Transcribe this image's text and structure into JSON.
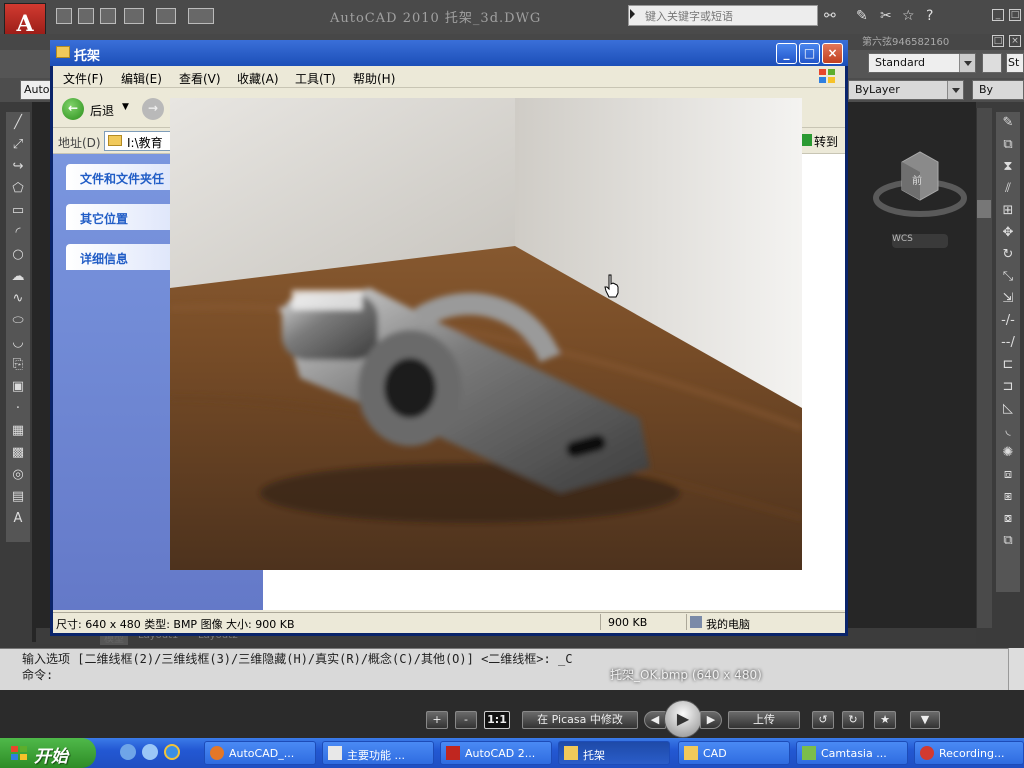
{
  "acad": {
    "title": "AutoCAD 2010  托架_3d.DWG",
    "search_placeholder": "键入关键字或短语",
    "user": "第六弦946582160",
    "style_combo": "Standard",
    "st_combo": "St",
    "workspace_combo": "Auto",
    "bylayer_combo": "ByLayer",
    "bylayer_right": "By",
    "wcs_label": "WCS",
    "cube_label": "前",
    "tabs": [
      "模型",
      "Layout1",
      "Layout2"
    ],
    "command_line1": "输入选项 [二维线框(2)/三维线框(3)/三维隐藏(H)/真实(R)/概念(C)/其他(O)] <二维线框>: _C",
    "command_line2": "命令:",
    "colors": {
      "logo_red": "#c0261f",
      "background": "#262626"
    }
  },
  "explorer": {
    "title": "托架",
    "menu": [
      "文件(F)",
      "编辑(E)",
      "查看(V)",
      "收藏(A)",
      "工具(T)",
      "帮助(H)"
    ],
    "back_label": "后退",
    "address_label": "地址(D)",
    "address_value": "I:\\教育",
    "goto_label": "转到",
    "tasks": [
      "文件和文件夹任",
      "其它位置",
      "详细信息"
    ],
    "status_left": "尺寸: 640 x 480 类型: BMP 图像 大小: 900 KB",
    "status_size": "900 KB",
    "status_location": "我的电脑",
    "colors": {
      "title_bar": "#1c4fb8",
      "sidebar": "#6e86d4"
    }
  },
  "picasa_overlay": {
    "caption": "托架_OK.bmp (640 x 480)",
    "zoom_in": "+",
    "zoom_out": "-",
    "actual_size": "1:1",
    "edit_button": "在 Picasa 中修改",
    "upload_button": "上传",
    "rotate_left": "↺",
    "rotate_right": "↻",
    "star": "★",
    "menu": "▼",
    "prev": "◀",
    "next": "▶",
    "play": "▶"
  },
  "taskbar": {
    "start_label": "开始",
    "items": [
      {
        "label": "AutoCAD_..."
      },
      {
        "label": "主要功能 ..."
      },
      {
        "label": "AutoCAD 2..."
      },
      {
        "label": "托架"
      },
      {
        "label": "CAD"
      },
      {
        "label": "Camtasia ..."
      },
      {
        "label": "Recording..."
      }
    ]
  }
}
